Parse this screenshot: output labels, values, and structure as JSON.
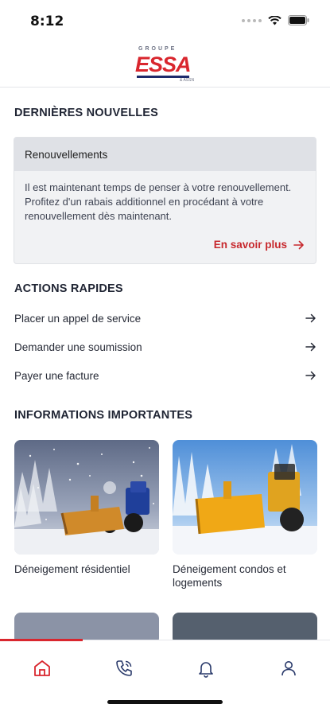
{
  "status_bar": {
    "time": "8:12"
  },
  "brand": {
    "top_text": "GROUPE",
    "name": "ESSA",
    "small_text": "& ASSN"
  },
  "news": {
    "section_title": "DERNIÈRES NOUVELLES",
    "card_title": "Renouvellements",
    "card_body": "Il est maintenant temps de penser à votre renouvellement. Profitez d'un rabais additionnel en procédant à votre renouvellement dès maintenant.",
    "more_label": "En savoir plus"
  },
  "quick_actions": {
    "section_title": "ACTIONS RAPIDES",
    "items": [
      {
        "label": "Placer un appel de service"
      },
      {
        "label": "Demander une soumission"
      },
      {
        "label": "Payer une facture"
      }
    ]
  },
  "important_info": {
    "section_title": "INFORMATIONS IMPORTANTES",
    "cards": [
      {
        "label": "Déneigement résidentiel"
      },
      {
        "label": "Déneigement condos et logements"
      }
    ]
  },
  "bottom_nav": {
    "items": [
      {
        "icon": "home-icon",
        "active": true
      },
      {
        "icon": "phone-icon",
        "active": false
      },
      {
        "icon": "bell-icon",
        "active": false
      },
      {
        "icon": "user-icon",
        "active": false
      }
    ],
    "accent_color": "#d9262e",
    "inactive_color": "#2a3a6b"
  },
  "colors": {
    "brand_red": "#d9262e",
    "brand_navy": "#1d2a6b",
    "card_bg": "#f1f2f4"
  }
}
